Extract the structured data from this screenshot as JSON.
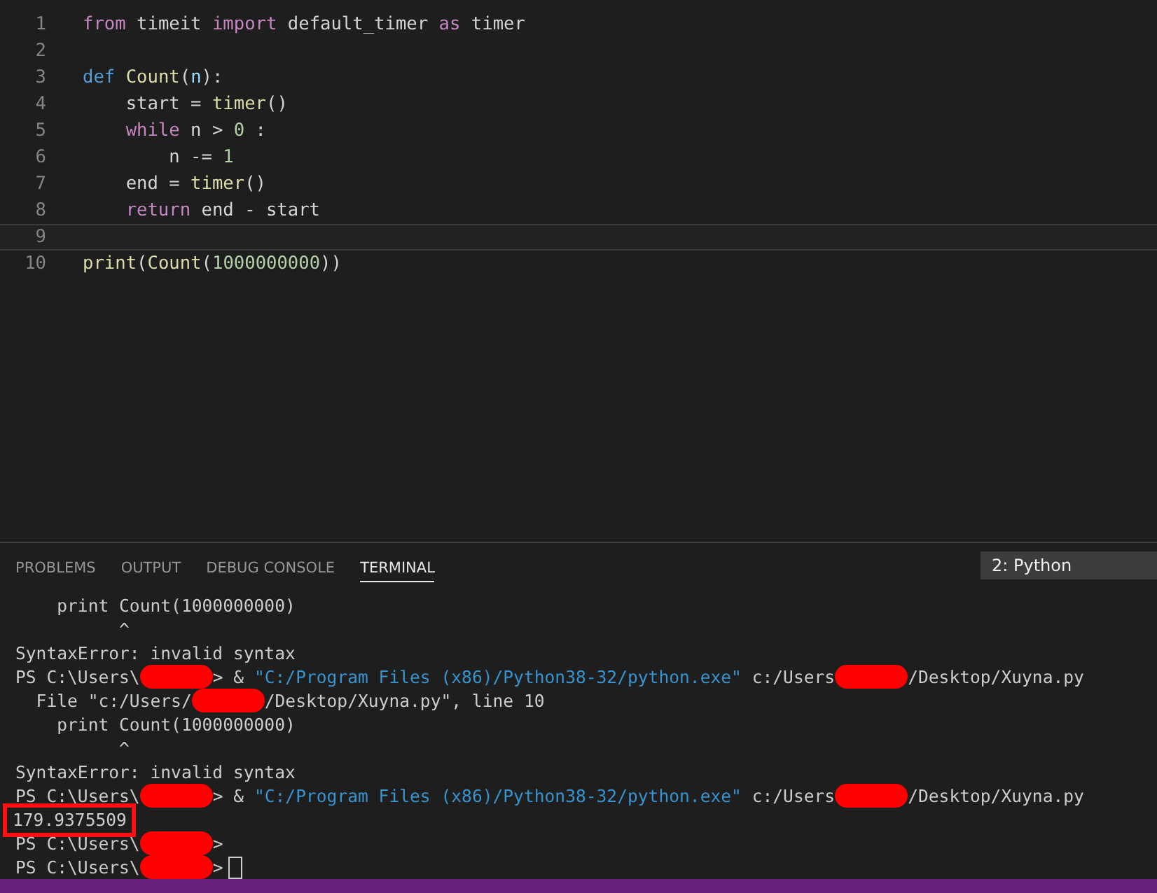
{
  "editor": {
    "lines": [
      {
        "number": "1",
        "current": false,
        "tokens": [
          {
            "text": "from",
            "kind": "keyword"
          },
          {
            "text": " timeit ",
            "kind": "plain"
          },
          {
            "text": "import",
            "kind": "keyword"
          },
          {
            "text": " default_timer ",
            "kind": "plain"
          },
          {
            "text": "as",
            "kind": "keyword"
          },
          {
            "text": " timer",
            "kind": "plain"
          }
        ]
      },
      {
        "number": "2",
        "current": false
      },
      {
        "number": "3",
        "current": false,
        "tokens": [
          {
            "text": "def ",
            "kind": "storage"
          },
          {
            "text": "Count",
            "kind": "function"
          },
          {
            "text": "(",
            "kind": "plain"
          },
          {
            "text": "n",
            "kind": "variable"
          },
          {
            "text": "):",
            "kind": "plain"
          }
        ]
      },
      {
        "number": "4",
        "current": false,
        "tokens": [
          {
            "text": "    start = ",
            "kind": "plain"
          },
          {
            "text": "timer",
            "kind": "function"
          },
          {
            "text": "()",
            "kind": "plain"
          }
        ]
      },
      {
        "number": "5",
        "current": false,
        "tokens": [
          {
            "text": "    while",
            "kind": "keyword"
          },
          {
            "text": " n > ",
            "kind": "plain"
          },
          {
            "text": "0",
            "kind": "number"
          },
          {
            "text": " :",
            "kind": "plain"
          }
        ]
      },
      {
        "number": "6",
        "current": false,
        "tokens": [
          {
            "text": "        n -= ",
            "kind": "plain"
          },
          {
            "text": "1",
            "kind": "number"
          }
        ]
      },
      {
        "number": "7",
        "current": false,
        "tokens": [
          {
            "text": "    end = ",
            "kind": "plain"
          },
          {
            "text": "timer",
            "kind": "function"
          },
          {
            "text": "()",
            "kind": "plain"
          }
        ]
      },
      {
        "number": "8",
        "current": false,
        "tokens": [
          {
            "text": "    return",
            "kind": "keyword"
          },
          {
            "text": " end - start",
            "kind": "plain"
          }
        ]
      },
      {
        "number": "9",
        "current": true
      },
      {
        "number": "10",
        "current": false,
        "tokens": [
          {
            "text": "print",
            "kind": "function"
          },
          {
            "text": "(",
            "kind": "plain"
          },
          {
            "text": "Count",
            "kind": "function"
          },
          {
            "text": "(",
            "kind": "plain"
          },
          {
            "text": "1000000000",
            "kind": "number"
          },
          {
            "text": "))",
            "kind": "plain"
          }
        ]
      }
    ]
  },
  "panel": {
    "tabs": [
      {
        "label": "PROBLEMS",
        "selected": false
      },
      {
        "label": "OUTPUT",
        "selected": false
      },
      {
        "label": "DEBUG CONSOLE",
        "selected": false
      },
      {
        "label": "TERMINAL",
        "selected": true
      }
    ],
    "terminal_select": "2: Python",
    "lines": [
      {
        "highlighted": false,
        "segments": [
          {
            "text": "    print Count(1000000000)",
            "kind": "plain"
          }
        ]
      },
      {
        "highlighted": false,
        "segments": [
          {
            "text": "          ^",
            "kind": "plain"
          }
        ]
      },
      {
        "highlighted": false,
        "segments": [
          {
            "text": "SyntaxError: invalid syntax",
            "kind": "plain"
          }
        ]
      },
      {
        "highlighted": false,
        "segments": [
          {
            "text": "PS C:\\Users\\",
            "kind": "plain"
          },
          {
            "kind": "redacted"
          },
          {
            "text": "> & ",
            "kind": "plain"
          },
          {
            "text": "\"C:/Program Files (x86)/Python38-32/python.exe\"",
            "kind": "string"
          },
          {
            "text": " c:/Users",
            "kind": "plain"
          },
          {
            "kind": "redacted"
          },
          {
            "text": "/Desktop/Xuyna.py",
            "kind": "plain"
          }
        ]
      },
      {
        "highlighted": false,
        "segments": [
          {
            "text": "  File \"c:/Users/",
            "kind": "plain"
          },
          {
            "kind": "redacted"
          },
          {
            "text": "/Desktop/Xuyna.py\", line 10",
            "kind": "plain"
          }
        ]
      },
      {
        "highlighted": false,
        "segments": [
          {
            "text": "    print Count(1000000000)",
            "kind": "plain"
          }
        ]
      },
      {
        "highlighted": false,
        "segments": [
          {
            "text": "          ^",
            "kind": "plain"
          }
        ]
      },
      {
        "highlighted": false,
        "segments": [
          {
            "text": "SyntaxError: invalid syntax",
            "kind": "plain"
          }
        ]
      },
      {
        "highlighted": false,
        "segments": [
          {
            "text": "PS C:\\Users\\",
            "kind": "plain"
          },
          {
            "kind": "redacted"
          },
          {
            "text": "> & ",
            "kind": "plain"
          },
          {
            "text": "\"C:/Program Files (x86)/Python38-32/python.exe\"",
            "kind": "string"
          },
          {
            "text": " c:/Users",
            "kind": "plain"
          },
          {
            "kind": "redacted"
          },
          {
            "text": "/Desktop/Xuyna.py",
            "kind": "plain"
          }
        ]
      },
      {
        "highlighted": true,
        "segments": [
          {
            "text": "179.9375509",
            "kind": "plain"
          }
        ]
      },
      {
        "highlighted": false,
        "segments": [
          {
            "text": "PS C:\\Users\\",
            "kind": "plain"
          },
          {
            "kind": "redacted"
          },
          {
            "text": ">",
            "kind": "plain"
          }
        ]
      },
      {
        "highlighted": false,
        "segments": [
          {
            "text": "PS C:\\Users\\",
            "kind": "plain"
          },
          {
            "kind": "redacted"
          },
          {
            "text": ">",
            "kind": "plain"
          },
          {
            "kind": "cursor"
          }
        ]
      }
    ]
  }
}
